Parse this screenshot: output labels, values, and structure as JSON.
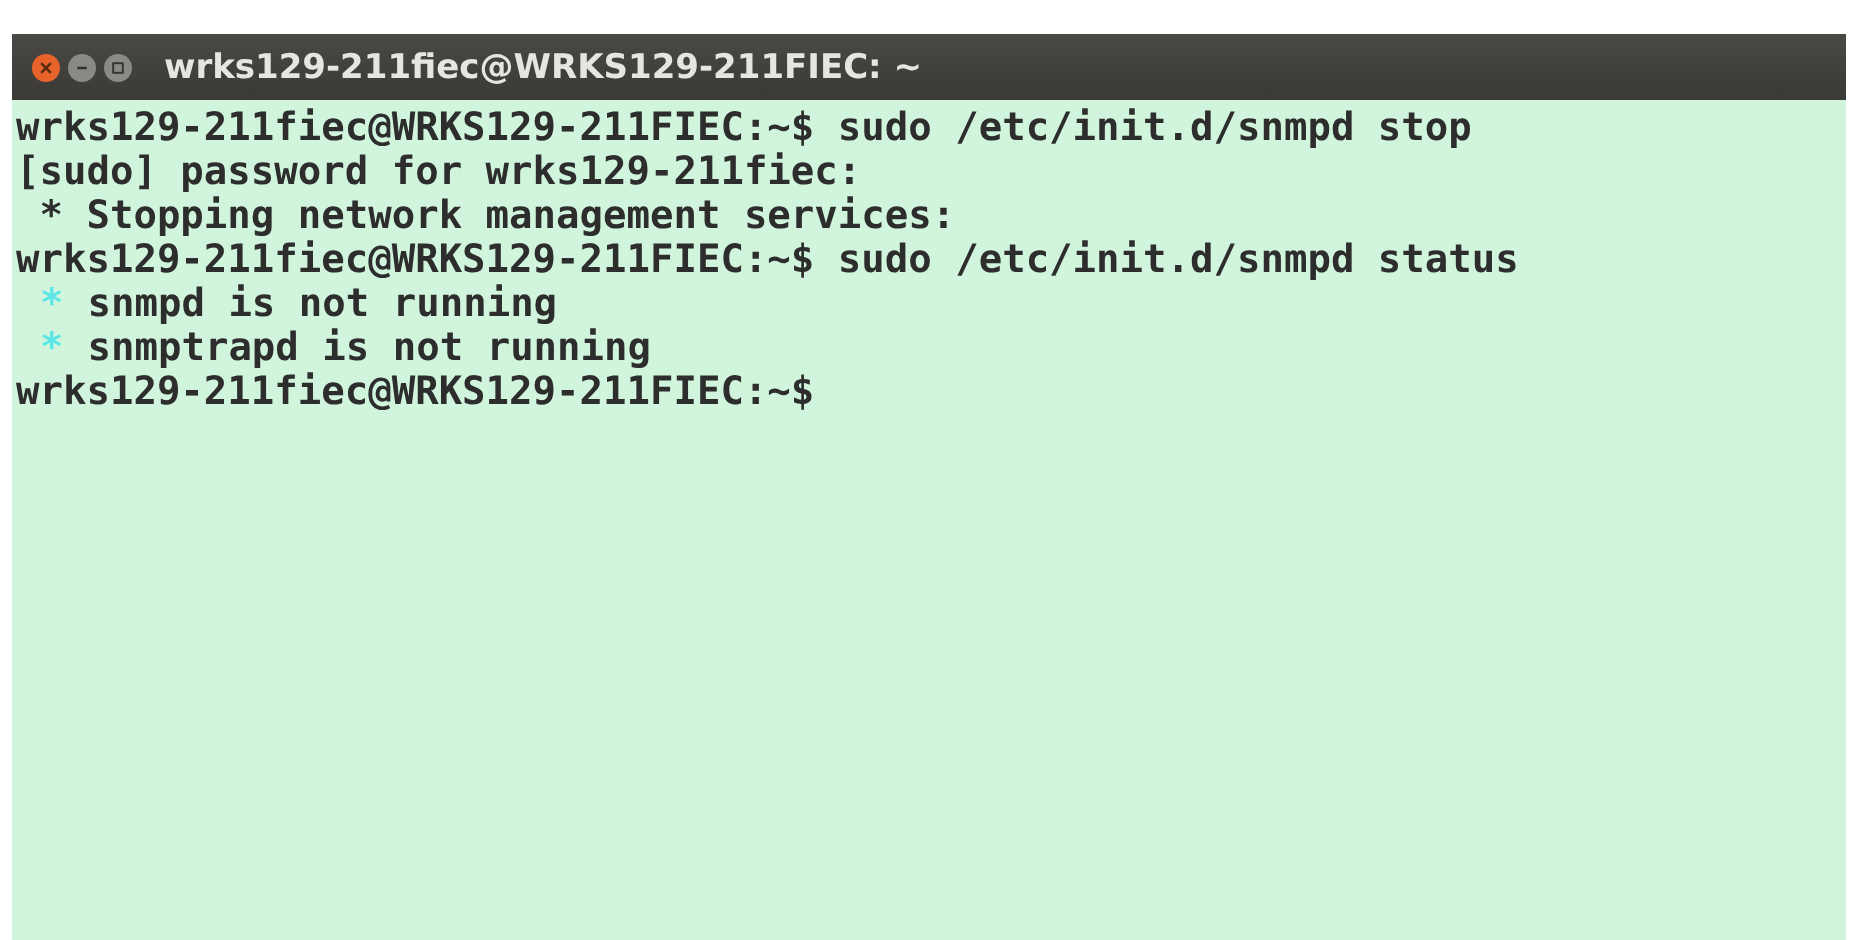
{
  "window": {
    "title": "wrks129-211fiec@WRKS129-211FIEC: ~"
  },
  "lines": [
    {
      "kind": "text",
      "text": "wrks129-211fiec@WRKS129-211FIEC:~$ sudo /etc/init.d/snmpd stop"
    },
    {
      "kind": "text",
      "text": "[sudo] password for wrks129-211fiec:"
    },
    {
      "kind": "text",
      "text": " * Stopping network management services:"
    },
    {
      "kind": "text",
      "text": "wrks129-211fiec@WRKS129-211FIEC:~$ sudo /etc/init.d/snmpd status"
    },
    {
      "kind": "status",
      "bullet": "*",
      "color": "#5ce6e6",
      "text": "snmpd is not running"
    },
    {
      "kind": "status",
      "bullet": "*",
      "color": "#5ce6e6",
      "text": "snmptrapd is not running"
    },
    {
      "kind": "text",
      "text": "wrks129-211fiec@WRKS129-211FIEC:~$"
    }
  ]
}
